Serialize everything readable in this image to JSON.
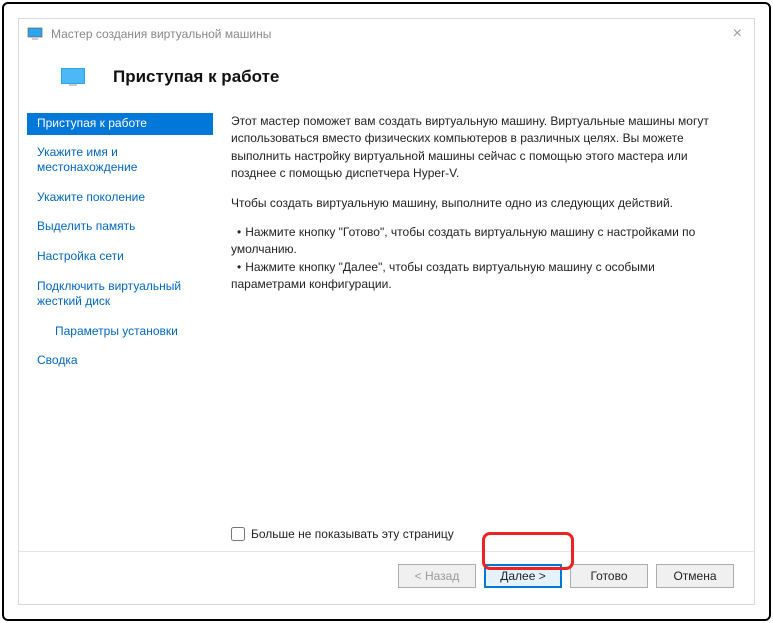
{
  "window": {
    "title": "Мастер создания виртуальной машины"
  },
  "header": {
    "title": "Приступая к работе"
  },
  "sidebar": {
    "items": [
      {
        "label": "Приступая к работе",
        "active": true
      },
      {
        "label": "Укажите имя и местонахождение"
      },
      {
        "label": "Укажите поколение"
      },
      {
        "label": "Выделить память"
      },
      {
        "label": "Настройка сети"
      },
      {
        "label": "Подключить виртуальный жесткий диск"
      },
      {
        "label": "Параметры установки",
        "indent": true
      },
      {
        "label": "Сводка"
      }
    ]
  },
  "content": {
    "intro": "Этот мастер поможет вам создать виртуальную машину. Виртуальные машины могут использоваться вместо физических компьютеров в различных целях. Вы можете выполнить настройку виртуальной машины сейчас с помощью этого мастера или позднее с помощью диспетчера Hyper-V.",
    "instruction": "Чтобы создать виртуальную машину, выполните одно из следующих действий.",
    "bullets": [
      "Нажмите кнопку \"Готово\", чтобы создать виртуальную машину с настройками по умолчанию.",
      "Нажмите кнопку \"Далее\", чтобы создать виртуальную машину с особыми параметрами конфигурации."
    ],
    "checkbox_label": "Больше не показывать эту страницу"
  },
  "footer": {
    "back": "< Назад",
    "next": "Далее >",
    "finish": "Готово",
    "cancel": "Отмена"
  }
}
